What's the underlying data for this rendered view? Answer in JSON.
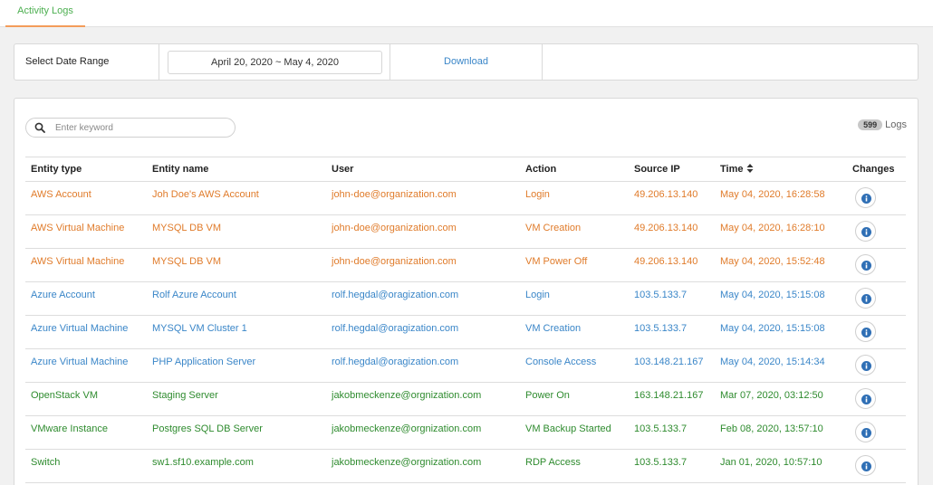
{
  "tab": {
    "label": "Activity Logs"
  },
  "filter": {
    "label": "Select Date Range",
    "date_range": "April 20, 2020 ~ May 4, 2020",
    "download_label": "Download"
  },
  "search": {
    "placeholder": "Enter keyword",
    "icon": "search-icon"
  },
  "log_count": {
    "count": "599",
    "label": "Logs"
  },
  "table": {
    "headers": [
      "Entity type",
      "Entity name",
      "User",
      "Action",
      "Source IP",
      "Time",
      "Changes"
    ],
    "rows": [
      {
        "type": "AWS Account",
        "name": "Joh Doe's AWS Account",
        "user": "john-doe@organization.com",
        "action": "Login",
        "ip": "49.206.13.140",
        "time": "May 04, 2020, 16:28:58",
        "color": "#e07b2a"
      },
      {
        "type": "AWS Virtual Machine",
        "name": "MYSQL DB VM",
        "user": "john-doe@organization.com",
        "action": "VM Creation",
        "ip": "49.206.13.140",
        "time": "May 04, 2020, 16:28:10",
        "color": "#e07b2a"
      },
      {
        "type": "AWS Virtual Machine",
        "name": "MYSQL DB VM",
        "user": "john-doe@organization.com",
        "action": "VM Power Off",
        "ip": "49.206.13.140",
        "time": "May 04, 2020, 15:52:48",
        "color": "#e07b2a"
      },
      {
        "type": "Azure Account",
        "name": "Rolf Azure Account",
        "user": "rolf.hegdal@oragization.com",
        "action": "Login",
        "ip": "103.5.133.7",
        "time": "May 04, 2020, 15:15:08",
        "color": "#3a86c8"
      },
      {
        "type": "Azure Virtual Machine",
        "name": "MYSQL VM Cluster 1",
        "user": "rolf.hegdal@oragization.com",
        "action": "VM Creation",
        "ip": "103.5.133.7",
        "time": "May 04, 2020, 15:15:08",
        "color": "#3a86c8"
      },
      {
        "type": "Azure Virtual Machine",
        "name": "PHP Application Server",
        "user": "rolf.hegdal@oragization.com",
        "action": "Console Access",
        "ip": "103.148.21.167",
        "time": "May 04, 2020, 15:14:34",
        "color": "#3a86c8"
      },
      {
        "type": "OpenStack VM",
        "name": "Staging Server",
        "user": "jakobmeckenze@orgnization.com",
        "action": "Power On",
        "ip": "163.148.21.167",
        "time": "Mar 07, 2020, 03:12:50",
        "color": "#2e8b2e"
      },
      {
        "type": "VMware Instance",
        "name": "Postgres SQL DB Server",
        "user": "jakobmeckenze@orgnization.com",
        "action": "VM Backup Started",
        "ip": "103.5.133.7",
        "time": "Feb 08, 2020, 13:57:10",
        "color": "#2e8b2e"
      },
      {
        "type": "Switch",
        "name": "sw1.sf10.example.com",
        "user": "jakobmeckenze@orgnization.com",
        "action": "RDP Access",
        "ip": "103.5.133.7",
        "time": "Jan 01, 2020, 10:57:10",
        "color": "#2e8b2e"
      }
    ]
  },
  "accent_colors": {
    "tab_text": "#4caf50",
    "tab_underline": "#f39c5a",
    "link": "#3a86c8"
  }
}
